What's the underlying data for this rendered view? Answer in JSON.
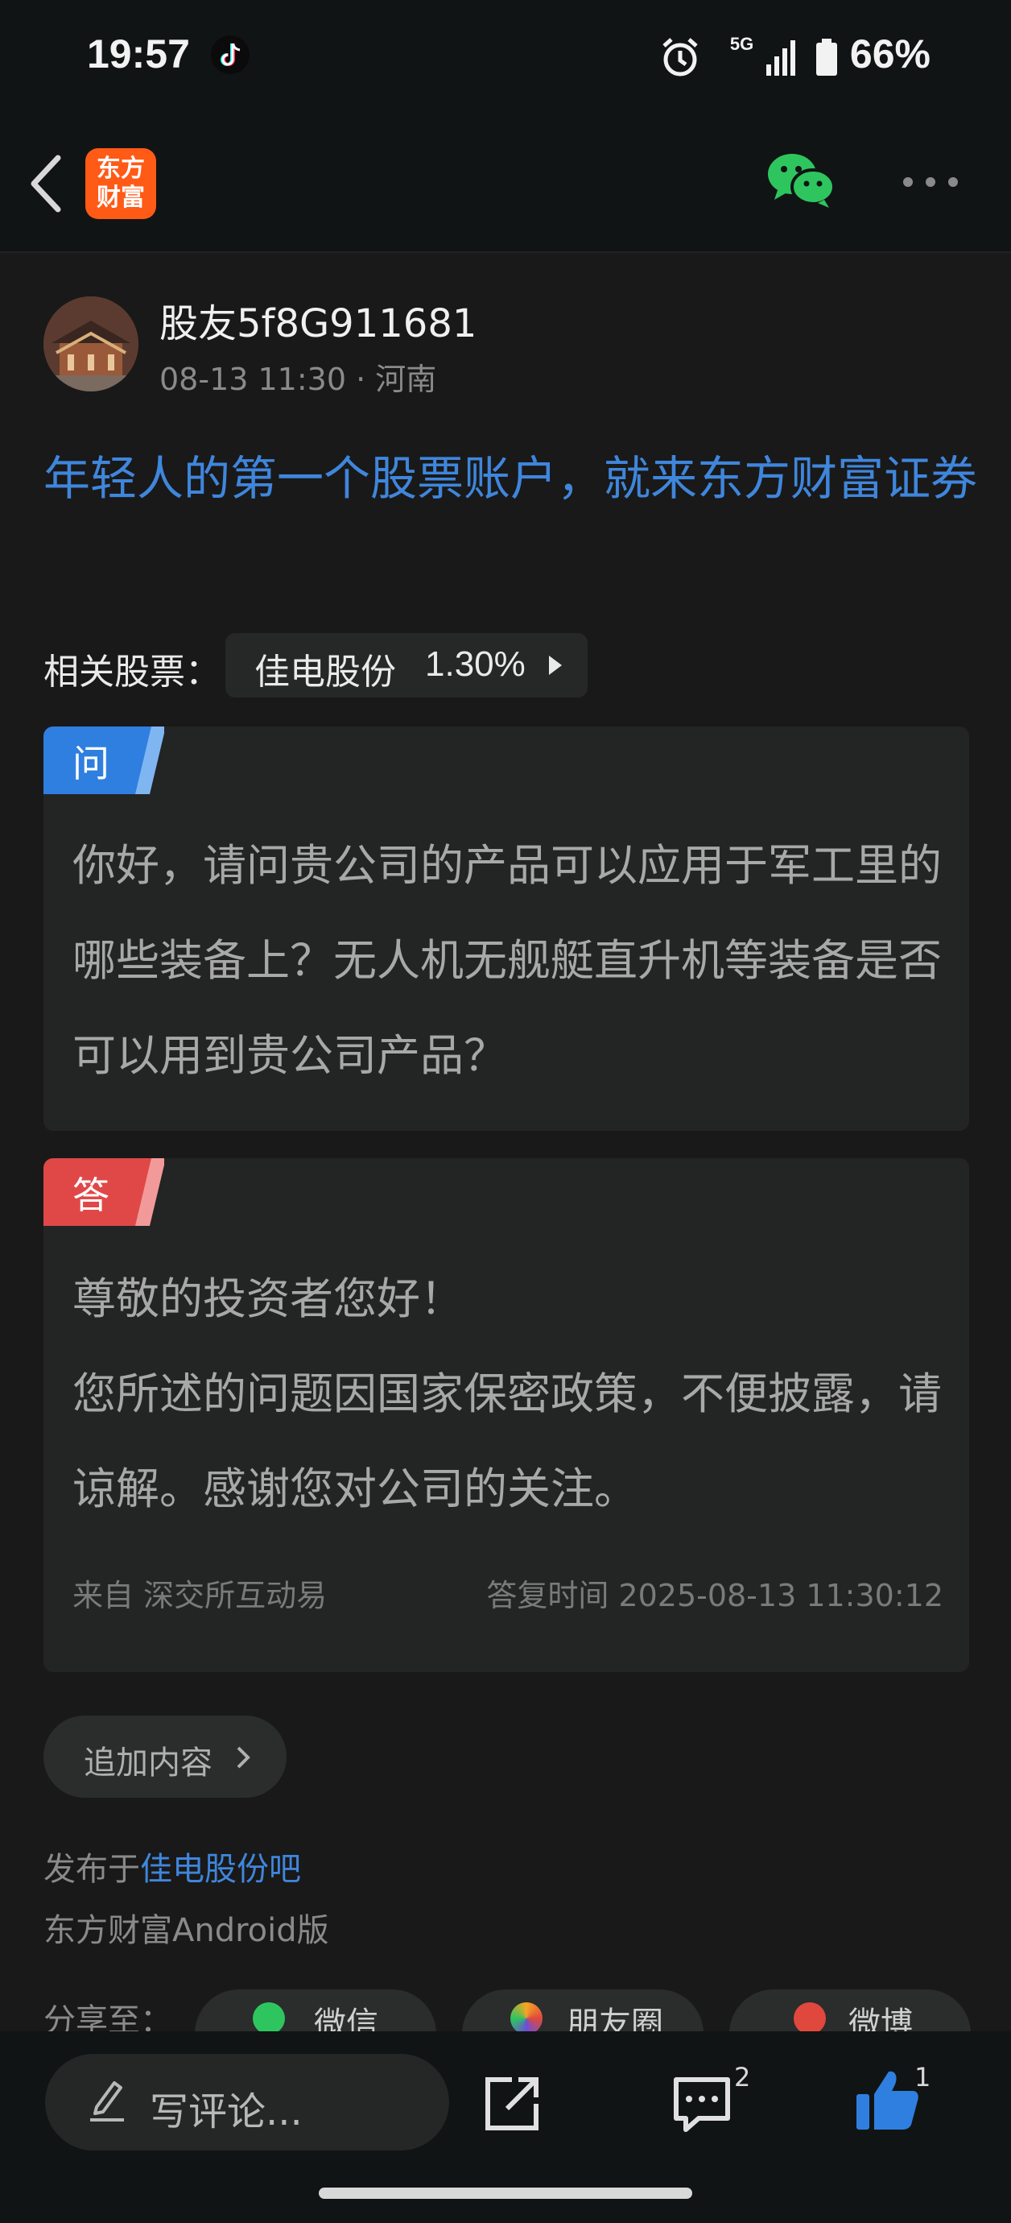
{
  "status_bar": {
    "time": "19:57",
    "network": "5G",
    "battery": "66%"
  },
  "nav": {
    "logo_text": "东方财富",
    "icons": [
      "back-icon",
      "wechat-icon",
      "more-icon"
    ]
  },
  "author": {
    "name": "股友5f8G911681",
    "meta": "08-13 11:30 · 河南"
  },
  "post": {
    "title": "年轻人的第一个股票账户，就来东方财富证券"
  },
  "related": {
    "label": "相关股票：",
    "stock_name": "佳电股份",
    "change": "1.30%"
  },
  "question": {
    "tag": "问",
    "text": "你好，请问贵公司的产品可以应用于军工里的哪些装备上？无人机无舰艇直升机等装备是否可以用到贵公司产品？"
  },
  "answer": {
    "tag": "答",
    "greeting": "尊敬的投资者您好！",
    "text": "您所述的问题因国家保密政策，不便披露，请谅解。感谢您对公司的关注。",
    "source": "来自 深交所互动易",
    "reply_time": "答复时间 2025-08-13 11:30:12"
  },
  "add_content": {
    "label": "追加内容"
  },
  "footer": {
    "posted_prefix": "发布于",
    "posted_link": "佳电股份吧",
    "client": "东方财富Android版"
  },
  "share": {
    "label": "分享至：",
    "targets": [
      "微信",
      "朋友圈",
      "微博"
    ]
  },
  "bottom": {
    "comment_placeholder": "写评论...",
    "comment_count": "2",
    "like_count": "1"
  },
  "colors": {
    "accent_blue": "#3f86dc",
    "question_tag": "#2f7fe0",
    "answer_tag": "#e04848",
    "brand_orange": "#ff5a16"
  }
}
